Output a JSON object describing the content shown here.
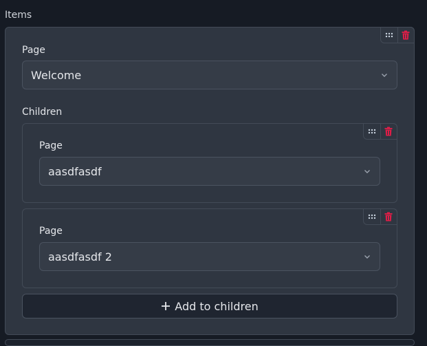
{
  "section": {
    "label": "Items"
  },
  "item": {
    "field_label": "Page",
    "page_value": "Welcome",
    "children_label": "Children",
    "children": [
      {
        "field_label": "Page",
        "page_value": "aasdfasdf"
      },
      {
        "field_label": "Page",
        "page_value": "aasdfasdf 2"
      }
    ],
    "add_children_label": "Add to children"
  },
  "icons": {
    "drag": "drag-handle-icon",
    "delete": "trash-icon",
    "chevron": "chevron-down-icon",
    "plus": "plus-icon"
  },
  "colors": {
    "background": "#161b24",
    "panel": "#2f3641",
    "danger": "#e11d48"
  }
}
